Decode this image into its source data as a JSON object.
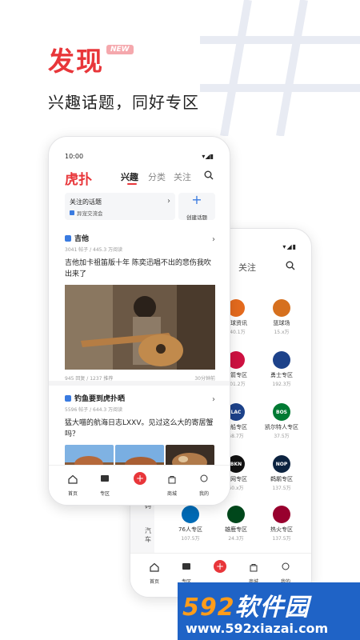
{
  "header": {
    "title": "发现",
    "badge": "NEW",
    "subtitle": "兴趣话题，同好专区"
  },
  "front_phone": {
    "status": {
      "time": "10:00"
    },
    "nav": {
      "logo": "虎扑",
      "tabs": [
        "兴趣",
        "分类",
        "关注"
      ],
      "active_tab": "兴趣"
    },
    "follow_card": {
      "title": "关注的话题",
      "item": "异宠交流会"
    },
    "create_card": {
      "label": "创建话题"
    },
    "posts": [
      {
        "topic": "吉他",
        "meta": "3041 帖子 / 445.3 万阅读",
        "text": "吉他加卡祖笛版十年 陈奕迅唱不出的悲伤我吹出来了",
        "footer_left": "945 回复 / 1237 推荐",
        "footer_right": "30分钟前"
      },
      {
        "topic": "钓鱼要到虎扑晒",
        "meta": "5596 帖子 / 644.3 万阅读",
        "text": "猛大喵的航海日志LXXV。见过这么大的寄居蟹吗？"
      }
    ],
    "tabbar": [
      "首页",
      "专区",
      "",
      "商城",
      "我的"
    ]
  },
  "back_phone": {
    "nav": {
      "tab": "关注"
    },
    "side": [
      "数码",
      "汽车"
    ],
    "communities": [
      {
        "name": "篮球资讯",
        "count": "740.1万",
        "color": "#e46a1e",
        "abbr": ""
      },
      {
        "name": "篮球场",
        "count": "15.x万",
        "color": "#d6701e",
        "abbr": ""
      },
      {
        "name": "火箭专区",
        "count": "201.2万",
        "color": "#ce1141",
        "abbr": ""
      },
      {
        "name": "勇士专区",
        "count": "192.3万",
        "color": "#1d428a",
        "abbr": ""
      },
      {
        "name": "快船专区",
        "count": "68.7万",
        "color": "#1d428a",
        "abbr": "LAC"
      },
      {
        "name": "凯尔特人专区",
        "count": "37.5万",
        "color": "#007a33",
        "abbr": "BOS"
      },
      {
        "name": "篮网专区",
        "count": "60.x万",
        "color": "#111111",
        "abbr": "BKN"
      },
      {
        "name": "鹈鹕专区",
        "count": "137.5万",
        "color": "#0c2340",
        "abbr": "NOP"
      },
      {
        "name": "76人专区",
        "count": "107.5万",
        "color": "#006bb6",
        "abbr": ""
      },
      {
        "name": "雄鹿专区",
        "count": "24.3万",
        "color": "#00471b",
        "abbr": ""
      },
      {
        "name": "热火专区",
        "count": "137.5万",
        "color": "#98002e",
        "abbr": ""
      }
    ],
    "tabbar": [
      "首页",
      "专区",
      "",
      "商城",
      "我的"
    ]
  },
  "watermark": {
    "brand_num": "592",
    "brand_text": "软件园",
    "url": "www.592xiazai.com"
  }
}
